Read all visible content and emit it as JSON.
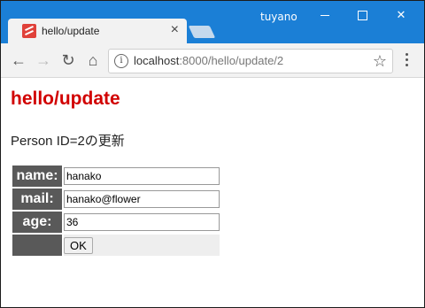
{
  "window": {
    "user": "tuyano"
  },
  "tab": {
    "title": "hello/update"
  },
  "address_bar": {
    "host": "localhost",
    "path": ":8000/hello/update/2"
  },
  "page": {
    "heading": "hello/update",
    "subtitle": "Person ID=2の更新",
    "form": {
      "fields": [
        {
          "label": "name:",
          "value": "hanako"
        },
        {
          "label": "mail:",
          "value": "hanako@flower"
        },
        {
          "label": "age:",
          "value": "36"
        }
      ],
      "submit_label": "OK"
    }
  },
  "colors": {
    "titlebar": "#1b7fd6",
    "heading": "#d10000",
    "label_bg": "#595959"
  }
}
